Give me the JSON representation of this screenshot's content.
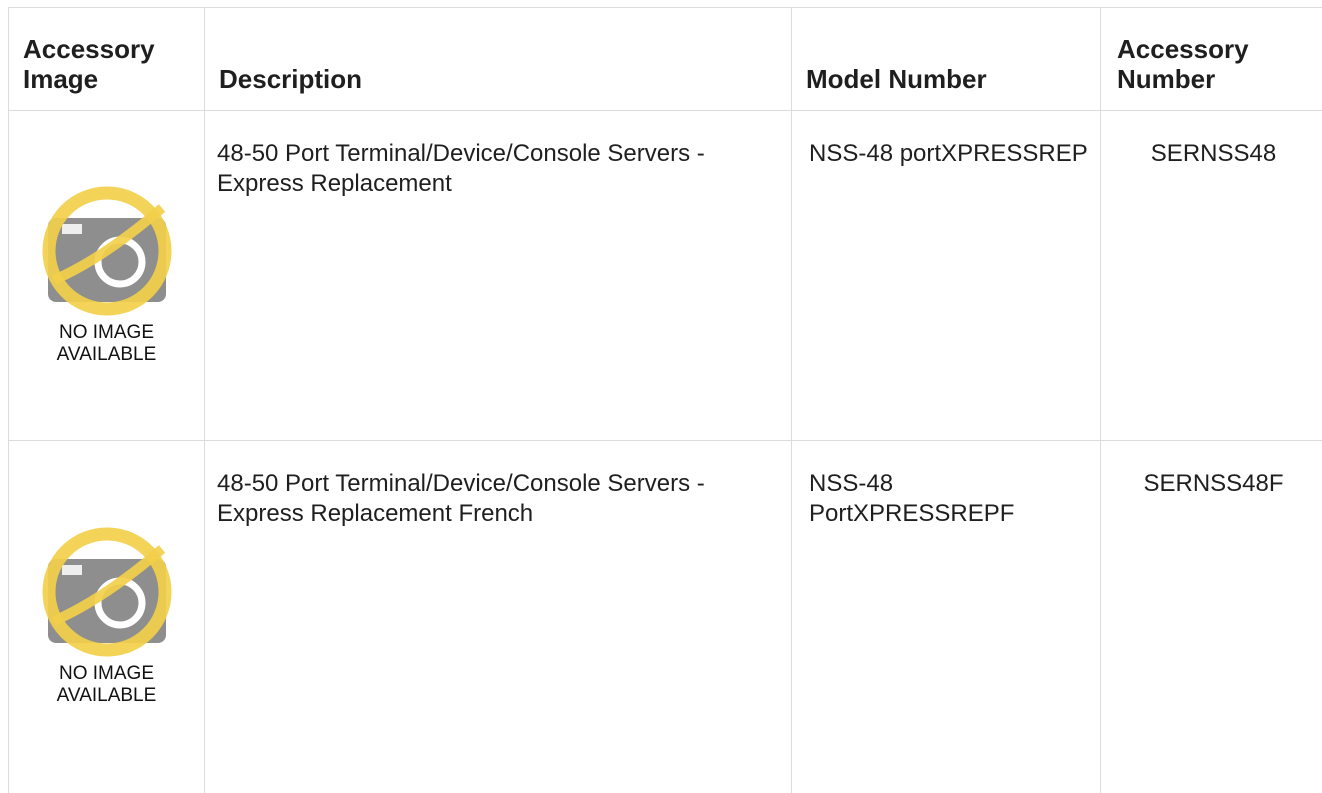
{
  "table": {
    "headers": {
      "image": "Accessory Image",
      "description": "Description",
      "model": "Model Number",
      "accessory_number": "Accessory Number"
    },
    "rows": [
      {
        "image_placeholder": "NO IMAGE AVAILABLE",
        "description": "48-50 Port Terminal/Device/Console Servers - Express Replacement",
        "model": "NSS-48 portXPRESSREP",
        "accessory_number": "SERNSS48"
      },
      {
        "image_placeholder": "NO IMAGE AVAILABLE",
        "description": "48-50 Port Terminal/Device/Console Servers - Express Replacement French",
        "model": "NSS-48 PortXPRESSREPF",
        "accessory_number": "SERNSS48F"
      }
    ]
  },
  "colors": {
    "border": "#dcdcdc",
    "placeholder_ring": "#f2cf4a",
    "placeholder_camera": "#8e8e8e"
  },
  "icons": {
    "placeholder": "no-image-camera-icon"
  }
}
